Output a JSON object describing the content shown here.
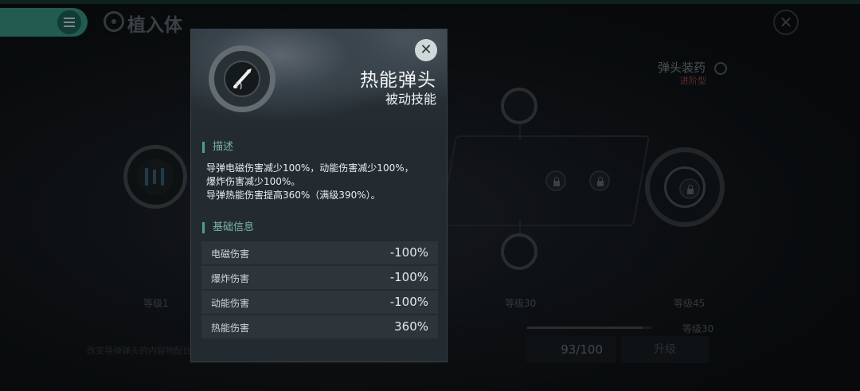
{
  "header": {
    "title": "植入体"
  },
  "tree": {
    "level_labels": [
      "等级1",
      "等级30",
      "等级45"
    ],
    "warhead_label": "弹头装药",
    "warhead_sub": "进阶型",
    "progress_level": "等级30",
    "progress_fraction": 0.93,
    "count": "93/100",
    "upgrade_label": "升级",
    "hint": "改变导弹弹头的内容物配比，"
  },
  "popup": {
    "skill_name": "热能弹头",
    "skill_type": "被动技能",
    "desc_heading": "描述",
    "desc_lines": [
      "导弹电磁伤害减少100%，动能伤害减少100%，",
      "爆炸伤害减少100%。",
      "导弹热能伤害提高360%（满级390%）。"
    ],
    "stats_heading": "基础信息",
    "stats": [
      {
        "label": "电磁伤害",
        "value": "-100%"
      },
      {
        "label": "爆炸伤害",
        "value": "-100%"
      },
      {
        "label": "动能伤害",
        "value": "-100%"
      },
      {
        "label": "热能伤害",
        "value": "360%"
      }
    ]
  },
  "colors": {
    "accent": "#3fa693",
    "panel": "#242b30",
    "warning": "#a8524a"
  }
}
